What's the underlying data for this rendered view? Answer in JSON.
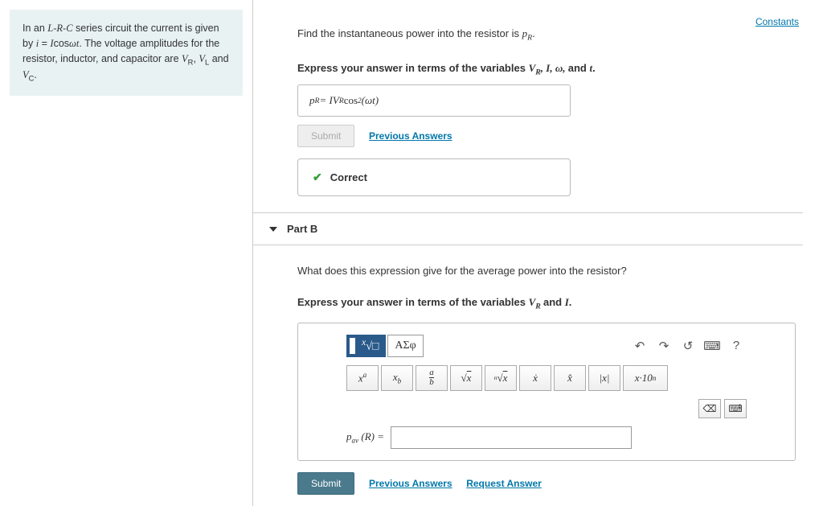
{
  "sidebar": {
    "problem_html": "In an <i>L-R-C</i> series circuit the current is given by <i>i = I</i>cos<i>ωt</i>. The voltage amplitudes for the resistor, inductor, and capacitor are <i>V</i><sub>R</sub>, <i>V</i><sub>L</sub> and <i>V</i><sub>C</sub>."
  },
  "constants_link": "Constants",
  "partA": {
    "prompt_line1": "Find the instantaneous power into the resistor is ",
    "prompt_var": "p",
    "prompt_sub": "R",
    "prompt_end": ".",
    "express": "Express your answer in terms of the variables ",
    "vars": "V_R, I, ω, ",
    "and": "and ",
    "tvar": "t",
    "dot": ".",
    "answer_prefix": "p",
    "answer_sub": "R",
    "answer_eq": " = ",
    "answer_body": "IV",
    "answer_body_sub": "R",
    "answer_cos": "cos",
    "answer_sup": "2",
    "answer_arg": " (ωt)",
    "submit": "Submit",
    "prev": "Previous Answers",
    "correct": "Correct"
  },
  "partB": {
    "title": "Part B",
    "question": "What does this expression give for the average power into the resistor?",
    "express": "Express your answer in terms of the variables ",
    "vars": "V_R ",
    "and": "and ",
    "Ivar": "I",
    "dot": ".",
    "tabs": {
      "math": "√",
      "greek": "ΑΣφ"
    },
    "symbols": [
      "xᵃ",
      "xᵦ",
      "a/b",
      "√x",
      "ⁿ√x",
      "ẋ",
      "x̂",
      "|x|",
      "x·10ⁿ"
    ],
    "eq_label_prefix": "p",
    "eq_label_sub": "av",
    "eq_label_arg": " (R) = ",
    "submit": "Submit",
    "prev": "Previous Answers",
    "request": "Request Answer"
  }
}
